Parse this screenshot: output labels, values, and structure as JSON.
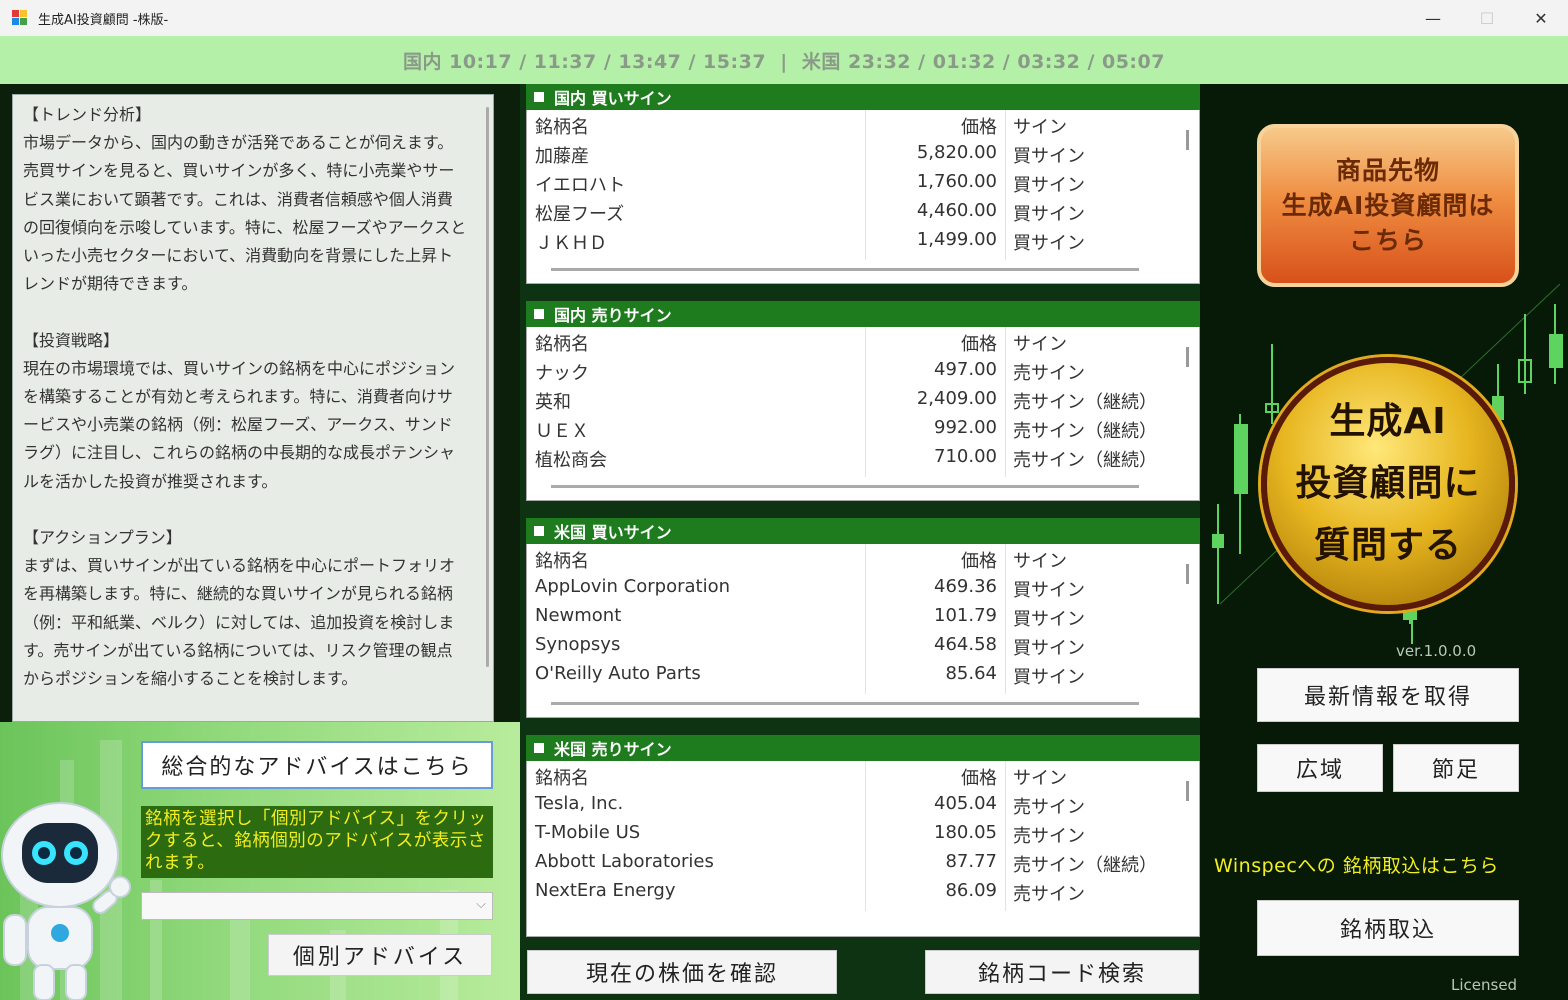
{
  "window": {
    "title": "生成AI投資顧問 -株版-",
    "minimize": "—",
    "maximize": "☐",
    "close": "✕"
  },
  "market_times": "国内 10:17 / 11:37 / 13:47 / 15:37  |  米国 23:32 / 01:32 / 03:32 / 05:07",
  "advice": {
    "text": "【トレンド分析】\n市場データから、国内の動きが活発であることが伺えます。売買サインを見ると、買いサインが多く、特に小売業やサービス業において顕著です。これは、消費者信頼感や個人消費の回復傾向を示唆しています。特に、松屋フーズやアークスといった小売セクターにおいて、消費動向を背景にした上昇トレンドが期待できます。\n\n【投資戦略】\n現在の市場環境では、買いサインの銘柄を中心にポジションを構築することが有効と考えられます。特に、消費者向けサービスや小売業の銘柄（例：松屋フーズ、アークス、サンドラグ）に注目し、これらの銘柄の中長期的な成長ポテンシャルを活かした投資が推奨されます。\n\n【アクションプラン】\nまずは、買いサインが出ている銘柄を中心にポートフォリオを再構築します。特に、継続的な買いサインが見られる銘柄（例：平和紙業、ベルク）に対しては、追加投資を検討します。売サインが出ている銘柄については、リスク管理の観点からポジションを縮小することを検討します。\n\n【市場見通し】\n今後の市場は、個人消費の回復を背景に、小売業やサービス業を中心に堅調に推移する可能性があります。しかし、一部のセクターでは調整局面も考えられるため、経済"
  },
  "overall_button": "総合的なアドバイスはこちら",
  "instruction": "銘柄を選択し「個別アドバイス」をクリックすると、銘柄個別のアドバイスが表示されます。",
  "stock_select_value": "",
  "individual_button": "個別アドバイス",
  "panels": [
    {
      "title": "国内 買いサイン",
      "headers": [
        "銘柄名",
        "価格",
        "サイン"
      ],
      "rows": [
        [
          "加藤産",
          "5,820.00",
          "買サイン"
        ],
        [
          "イエロハト",
          "1,760.00",
          "買サイン"
        ],
        [
          "松屋フーズ",
          "4,460.00",
          "買サイン"
        ],
        [
          "ＪＫＨＤ",
          "1,499.00",
          "買サイン"
        ]
      ]
    },
    {
      "title": "国内 売りサイン",
      "headers": [
        "銘柄名",
        "価格",
        "サイン"
      ],
      "rows": [
        [
          "ナック",
          "497.00",
          "売サイン"
        ],
        [
          "英和",
          "2,409.00",
          "売サイン（継続）"
        ],
        [
          "ＵＥＸ",
          "992.00",
          "売サイン（継続）"
        ],
        [
          "植松商会",
          "710.00",
          "売サイン（継続）"
        ]
      ]
    },
    {
      "title": "米国 買いサイン",
      "headers": [
        "銘柄名",
        "価格",
        "サイン"
      ],
      "rows": [
        [
          "AppLovin Corporation",
          "469.36",
          "買サイン"
        ],
        [
          "Newmont",
          "101.79",
          "買サイン"
        ],
        [
          "Synopsys",
          "464.58",
          "買サイン"
        ],
        [
          "O'Reilly Auto Parts",
          "85.64",
          "買サイン"
        ]
      ]
    },
    {
      "title": "米国 売りサイン",
      "headers": [
        "銘柄名",
        "価格",
        "サイン"
      ],
      "rows": [
        [
          "Tesla, Inc.",
          "405.04",
          "売サイン"
        ],
        [
          "T-Mobile US",
          "180.05",
          "売サイン"
        ],
        [
          "Abbott Laboratories",
          "87.77",
          "売サイン（継続）"
        ],
        [
          "NextEra Energy",
          "86.09",
          "売サイン"
        ]
      ]
    }
  ],
  "center_buttons": {
    "check_price": "現在の株価を確認",
    "code_search": "銘柄コード検索"
  },
  "right": {
    "futures_lines": [
      "商品先物",
      "生成AI投資顧問は",
      "こちら"
    ],
    "ask_lines": [
      "生成AI",
      "投資顧問に",
      "質問する"
    ],
    "version": "ver.1.0.0.0",
    "refresh": "最新情報を取得",
    "wide": "広域",
    "settings": "節足",
    "winspec": "Winspecへの 銘柄取込はこちら",
    "import": "銘柄取込",
    "licensed": "Licensed"
  }
}
